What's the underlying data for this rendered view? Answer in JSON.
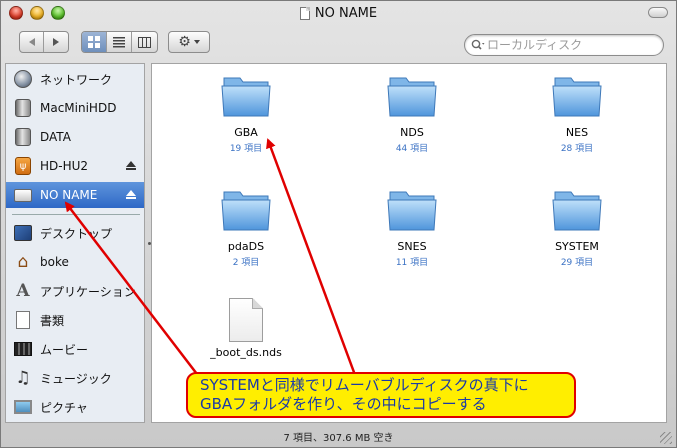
{
  "window": {
    "title": "NO NAME"
  },
  "toolbar": {
    "search_placeholder": "ローカルディスク"
  },
  "sidebar": {
    "devices": [
      {
        "label": "ネットワーク",
        "icon": "globe-icon"
      },
      {
        "label": "MacMiniHDD",
        "icon": "hard-disk-icon"
      },
      {
        "label": "DATA",
        "icon": "hard-disk-icon"
      },
      {
        "label": "HD-HU2",
        "icon": "usb-disk-icon",
        "eject": true
      },
      {
        "label": "NO NAME",
        "icon": "removable-disk-icon",
        "eject": true,
        "selected": true
      }
    ],
    "places": [
      {
        "label": "デスクトップ",
        "icon": "desktop-icon"
      },
      {
        "label": "boke",
        "icon": "home-icon"
      },
      {
        "label": "アプリケーション",
        "icon": "applications-icon"
      },
      {
        "label": "書類",
        "icon": "documents-icon"
      },
      {
        "label": "ムービー",
        "icon": "movies-icon"
      },
      {
        "label": "ミュージック",
        "icon": "music-icon"
      },
      {
        "label": "ピクチャ",
        "icon": "pictures-icon"
      }
    ]
  },
  "files": [
    {
      "name": "GBA",
      "count": "19 項目",
      "kind": "folder"
    },
    {
      "name": "NDS",
      "count": "44 項目",
      "kind": "folder"
    },
    {
      "name": "NES",
      "count": "28 項目",
      "kind": "folder"
    },
    {
      "name": "pdaDS",
      "count": "2 項目",
      "kind": "folder"
    },
    {
      "name": "SNES",
      "count": "11 項目",
      "kind": "folder"
    },
    {
      "name": "SYSTEM",
      "count": "29 項目",
      "kind": "folder"
    },
    {
      "name": "_boot_ds.nds",
      "count": "",
      "kind": "document"
    }
  ],
  "status": {
    "text": "7 項目、307.6 MB 空き"
  },
  "annotation": {
    "line1": "SYSTEMと同様でリムーバブルディスクの真下に",
    "line2": "GBAフォルダを作り、その中にコピーする",
    "border_color": "#e00000",
    "fill_color": "#ffee00",
    "text_color": "#1a3aa8"
  }
}
